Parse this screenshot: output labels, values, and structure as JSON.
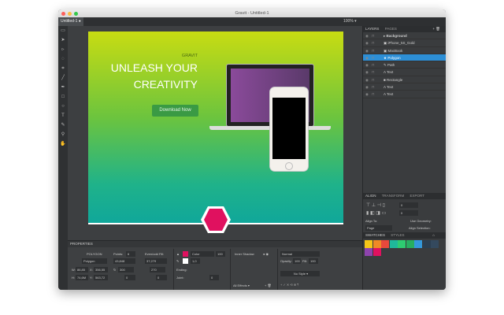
{
  "window": {
    "title": "Gravit - Untitled-1",
    "tab": "Untitled-1 ●",
    "zoom": "100% ▾"
  },
  "tools": [
    "page-icon",
    "pointer-icon",
    "subselect-icon",
    "lasso-icon",
    "crop-icon",
    "line-icon",
    "pen-icon",
    "rectangle-icon",
    "ellipse-icon",
    "text-icon",
    "eyedropper-icon",
    "zoom-icon",
    "hand-icon"
  ],
  "artboard": {
    "brand": "GRAVIT",
    "headline1": "UNLEASH YOUR",
    "headline2": "CREATIVITY",
    "cta": "Download Now"
  },
  "layers_panel": {
    "tab_layers": "LAYERS",
    "tab_pages": "PAGES",
    "items": [
      {
        "name": "Background",
        "icon": "▸",
        "selected": false
      },
      {
        "name": "iPhone_5S_Gold",
        "icon": "▣",
        "selected": false
      },
      {
        "name": "MacBook",
        "icon": "▣",
        "selected": false
      },
      {
        "name": "Polygon",
        "icon": "★",
        "selected": true
      },
      {
        "name": "Path",
        "icon": "✎",
        "selected": false
      },
      {
        "name": "Text",
        "icon": "A",
        "selected": false
      },
      {
        "name": "Rectangle",
        "icon": "■",
        "selected": false
      },
      {
        "name": "Text",
        "icon": "A",
        "selected": false
      },
      {
        "name": "Text",
        "icon": "A",
        "selected": false
      }
    ]
  },
  "align_panel": {
    "tabs": [
      "ALIGN",
      "TRANSFORM",
      "EXPORT"
    ],
    "spacing_h": "0",
    "spacing_v": "0",
    "align_to_label": "Align To:",
    "align_to_value": "Page",
    "use_geometry": "Use Geometry:",
    "align_selection": "Align Selection:"
  },
  "swatches_panel": {
    "tabs": [
      "SWATCHES",
      "STYLES"
    ],
    "colors": [
      "#f5c518",
      "#ef8a26",
      "#e8493c",
      "#1fb89a",
      "#2ecc71",
      "#27ae60",
      "#3498db",
      "#2c3e50",
      "#34495e",
      "#8e44ad",
      "#e0115f"
    ]
  },
  "properties": {
    "title": "PROPERTIES",
    "type": "POLYGON",
    "name": "Polygon",
    "points_label": "Points:",
    "points": "6",
    "evenodd_label": "Even/odd Fill:",
    "width_val": "43,848",
    "height_val": "37,279",
    "w_label": "W:",
    "w": "86,85",
    "x_label": "X:",
    "x": "356,55",
    "h_label": "H:",
    "h": "74,6M",
    "y_label": "Y:",
    "y": "563,72",
    "rotation": "300",
    "angle": "270",
    "corner1": "0",
    "corner2": "0",
    "fill_type": "Color",
    "fill_opacity": "100",
    "stroke_width": "1,0",
    "ending_label": "Ending:",
    "joint_label": "Joint:",
    "miter": "0",
    "effect": "Inner Shadow",
    "effects_filter": "All Effects ▾",
    "blend": "Normal",
    "opacity_label": "Opacity:",
    "opacity": "100",
    "fill_label": "Fill:",
    "fill": "100",
    "style": "No Style ▾"
  },
  "colors": {
    "accent": "#2d8fd6",
    "polygon": "#e0115f"
  }
}
